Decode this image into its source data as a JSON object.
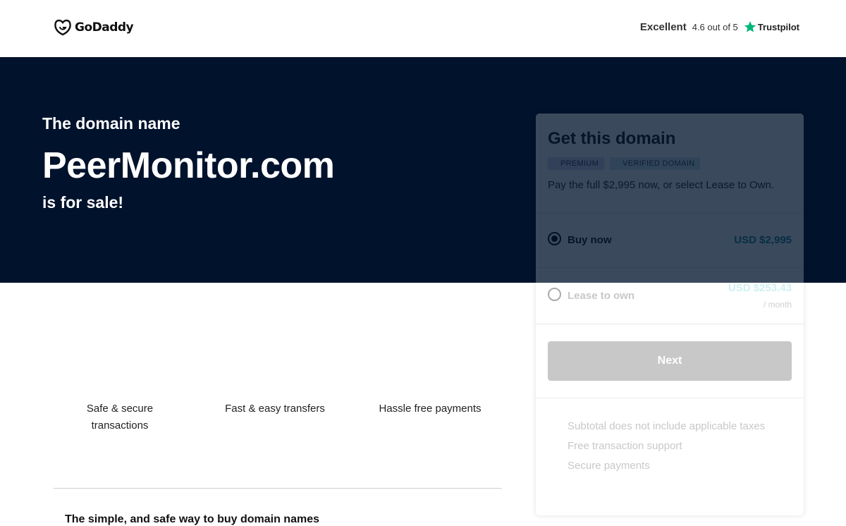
{
  "header": {
    "logo_text": "GoDaddy",
    "rating_word": "Excellent",
    "rating_score": "4.6 out of 5",
    "rating_brand": "Trustpilot"
  },
  "hero": {
    "pre": "The domain name",
    "domain": "PeerMonitor.com",
    "post": "is for sale!"
  },
  "features": [
    {
      "label": "Safe & secure transactions"
    },
    {
      "label": "Fast & easy transfers"
    },
    {
      "label": "Hassle free payments"
    }
  ],
  "bottom_heading": "The simple, and safe way to buy domain names",
  "card": {
    "title": "Get this domain",
    "badges": [
      "PREMIUM",
      "VERIFIED DOMAIN"
    ],
    "description": "Pay the full $2,995 now, or select Lease to Own.",
    "options": [
      {
        "label": "Buy now",
        "price": "USD $2,995",
        "selected": true
      },
      {
        "label": "Lease to own",
        "price": "USD $253.43",
        "sub": "/ month",
        "selected": false
      }
    ],
    "next_label": "Next",
    "info": [
      "Subtotal does not include applicable taxes",
      "Free transaction support",
      "Secure payments"
    ]
  },
  "colors": {
    "hero_bg": "#00122c",
    "price_accent": "#1a8a94",
    "trustpilot_star": "#00b67a"
  },
  "icons": {
    "logo": "godaddy-logo-icon",
    "rating": "trustpilot-star-icon"
  }
}
